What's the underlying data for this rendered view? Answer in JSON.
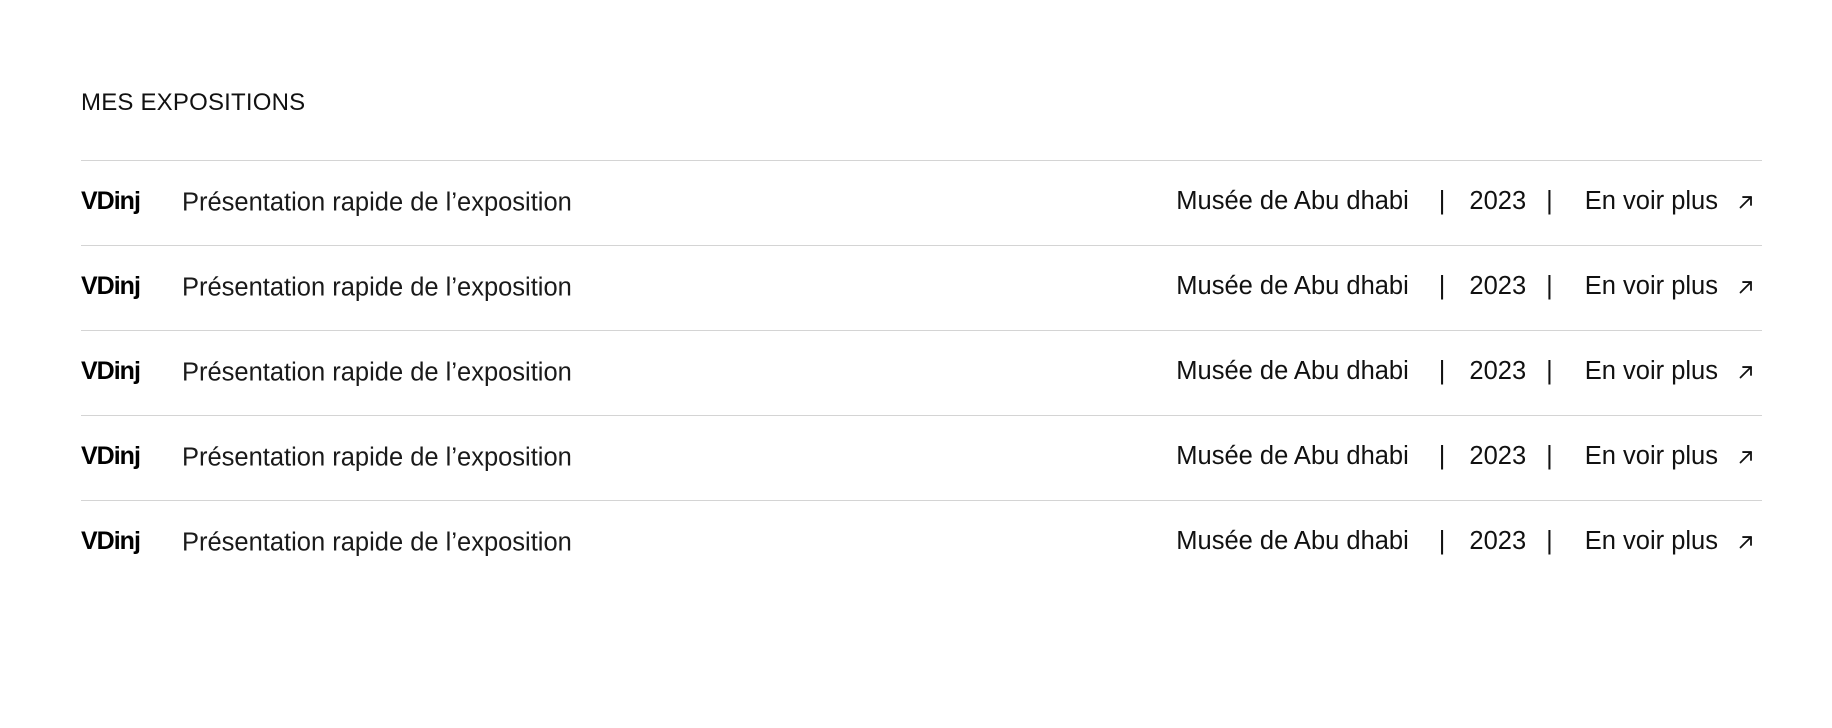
{
  "section": {
    "title": "MES EXPOSITIONS"
  },
  "exhibitions": [
    {
      "logo": "VDinj",
      "description": "Présentation rapide de l’exposition",
      "museum": "Musée de Abu dhabi",
      "separator": "|",
      "year": "2023",
      "link_label": "En voir plus",
      "link_icon": "arrow-up-right-icon"
    },
    {
      "logo": "VDinj",
      "description": "Présentation rapide de l’exposition",
      "museum": "Musée de Abu dhabi",
      "separator": "|",
      "year": "2023",
      "link_label": "En voir plus",
      "link_icon": "arrow-up-right-icon"
    },
    {
      "logo": "VDinj",
      "description": "Présentation rapide de l’exposition",
      "museum": "Musée de Abu dhabi",
      "separator": "|",
      "year": "2023",
      "link_label": "En voir plus",
      "link_icon": "arrow-up-right-icon"
    },
    {
      "logo": "VDinj",
      "description": "Présentation rapide de l’exposition",
      "museum": "Musée de Abu dhabi",
      "separator": "|",
      "year": "2023",
      "link_label": "En voir plus",
      "link_icon": "arrow-up-right-icon"
    },
    {
      "logo": "VDinj",
      "description": "Présentation rapide de l’exposition",
      "museum": "Musée de Abu dhabi",
      "separator": "|",
      "year": "2023",
      "link_label": "En voir plus",
      "link_icon": "arrow-up-right-icon"
    }
  ],
  "colors": {
    "text": "#111111",
    "divider": "#d4d4d4",
    "background": "#ffffff"
  }
}
